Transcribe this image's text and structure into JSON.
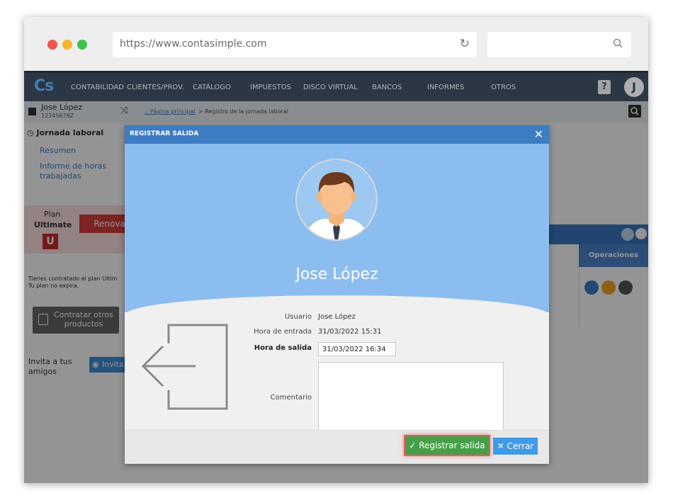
{
  "browser": {
    "url": "https://www.contasimple.com"
  },
  "app": {
    "logo": "Cs",
    "nav": [
      "CONTABILIDAD",
      "CLIENTES/PROV.",
      "CATÁLOGO",
      "IMPUESTOS",
      "DISCO VIRTUAL",
      "BANCOS",
      "INFORMES",
      "OTROS"
    ],
    "help_label": "?",
    "avatar_letter": "J"
  },
  "page": {
    "user_name": "Jose López",
    "user_id": "12345678Z",
    "breadcrumb_home": ":: Página principal",
    "breadcrumb_rest": " > Registro de la jornada laboral",
    "sidebar": {
      "section_title": "Jornada laboral",
      "items": [
        "Resumen",
        "Informe de horas",
        "trabajadas"
      ],
      "plan_label": "Plan",
      "plan_name": "Ultimate",
      "plan_badge": "U",
      "renew_label": "Renovar",
      "plan_note_1": "Tienes contratado el plan Ultim",
      "plan_note_2": "Tu plan no expira.",
      "contract_1": "Contratar otros",
      "contract_2": "productos",
      "invite_1": "Invita a tus",
      "invite_2": "amigos",
      "invite_btn": "Invita"
    },
    "table": {
      "ops_header": "Operaciones"
    }
  },
  "modal": {
    "title": "REGISTRAR SALIDA",
    "close_label": "✕",
    "person_name": "Jose López",
    "fields": {
      "user_label": "Usuario",
      "user_value": "Jose López",
      "entry_label": "Hora de entrada",
      "entry_value": "31/03/2022 15:31",
      "exit_label": "Hora de salida",
      "exit_value": "31/03/2022 16:34",
      "comment_label": "Comentario",
      "comment_value": ""
    },
    "buttons": {
      "register": "Registrar salida",
      "close": "Cerrar"
    }
  },
  "colors": {
    "accent": "#3d7dc4",
    "hero": "#8bbdf0",
    "success": "#46a049",
    "navbar": "#3a4a5d"
  }
}
